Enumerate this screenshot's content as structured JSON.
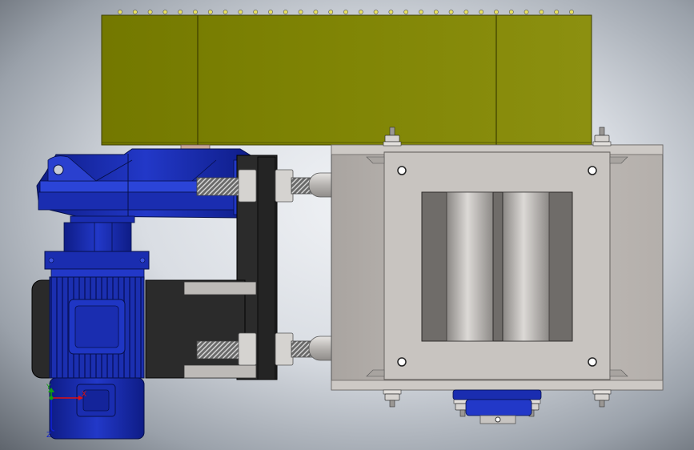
{
  "colors": {
    "hopper": "#7f8405",
    "hopper_dark": "#6a6e03",
    "motor_blue": "#1a2fb8",
    "motor_blue_dark": "#0d1a7a",
    "valve_body": "#b9b4b0",
    "valve_dark": "#6e6b68",
    "frame": "#2a2a2a",
    "bolt_yellow": "#e8e060",
    "axis_x": "#e01010",
    "axis_y": "#10a010",
    "axis_z": "#1020d0"
  },
  "icons": {
    "view_triad": "xyz-axis-triad-icon"
  },
  "triad": {
    "x_label": "X",
    "y_label": "Y",
    "z_label": "Z"
  }
}
